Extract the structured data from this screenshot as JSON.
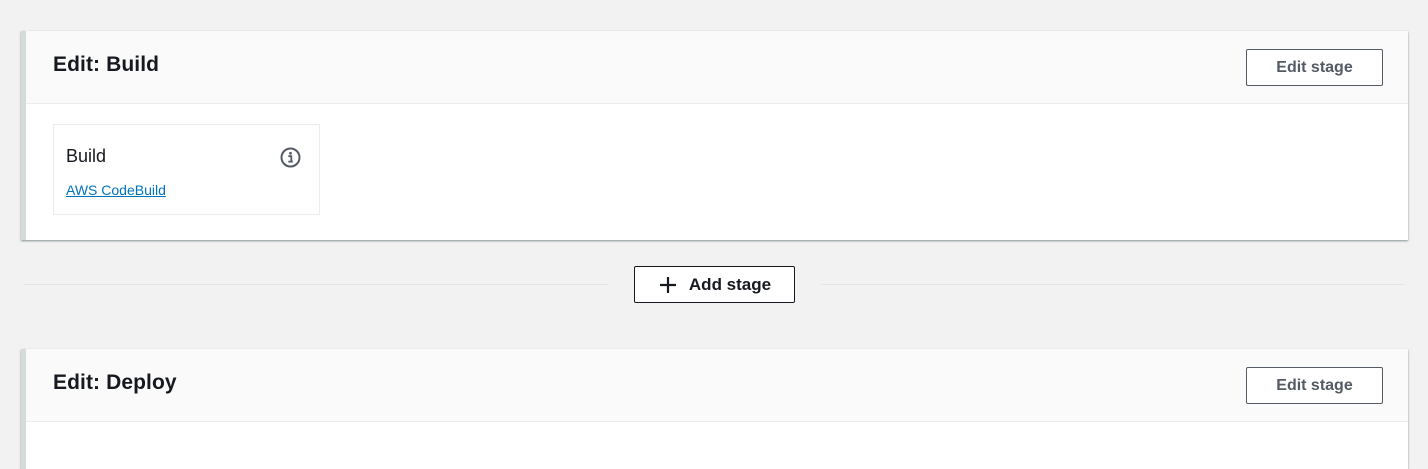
{
  "stages": [
    {
      "title": "Edit: Build",
      "edit_button": "Edit stage",
      "actions": [
        {
          "name": "Build",
          "provider": "AWS CodeBuild",
          "icon": "info-icon"
        }
      ]
    },
    {
      "title": "Edit: Deploy",
      "edit_button": "Edit stage"
    }
  ],
  "add_stage": {
    "label": "Add stage",
    "icon": "plus-icon"
  },
  "colors": {
    "background": "#f2f2f2",
    "card": "#ffffff",
    "header": "#fafafa",
    "link": "#0073bb",
    "text": "#16191f",
    "button_text": "#545b64"
  }
}
